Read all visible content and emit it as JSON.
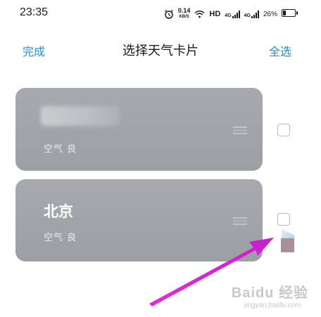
{
  "status_bar": {
    "time": "23:35",
    "net_speed_value": "0.14",
    "net_speed_unit": "KB/S",
    "hd_label": "HD",
    "signal_tag_1": "4G",
    "signal_tag_2": "4G",
    "battery_percent": "26%",
    "battery_level": 0.26,
    "icons": [
      "alarm-icon",
      "wifi-icon",
      "signal-icon",
      "signal-icon",
      "battery-icon"
    ]
  },
  "header": {
    "done_label": "完成",
    "title": "选择天气卡片",
    "select_all_label": "全选"
  },
  "cards": [
    {
      "city": "",
      "air_quality": "空气 良",
      "checked": false
    },
    {
      "city": "北京",
      "air_quality": "空气 良",
      "checked": false
    }
  ],
  "colors": {
    "accent": "#1e8fd7",
    "card_bg": "#a3a7ab",
    "arrow": "#e32bd8"
  },
  "watermark": {
    "top": "Baidu 经验",
    "bottom": "jingyan.baidu.com"
  }
}
